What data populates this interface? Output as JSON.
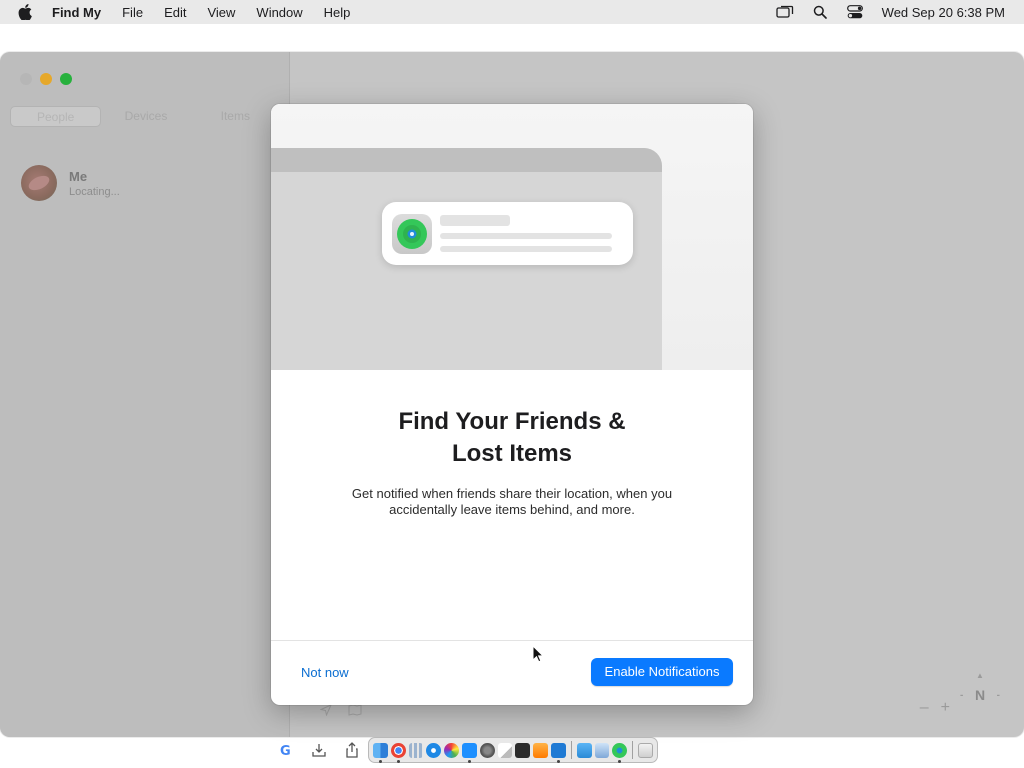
{
  "menubar": {
    "app_name": "Find My",
    "items": [
      "File",
      "Edit",
      "View",
      "Window",
      "Help"
    ],
    "clock": "Wed Sep 20  6:38 PM"
  },
  "sidebar": {
    "tabs": [
      "People",
      "Devices",
      "Items"
    ],
    "person": {
      "name": "Me",
      "status": "Locating..."
    }
  },
  "map": {
    "zoom_out": "–",
    "zoom_in": "+",
    "compass": "N"
  },
  "modal": {
    "title_line1": "Find Your Friends &",
    "title_line2": "Lost Items",
    "body": "Get notified when friends share their location, when you accidentally leave items behind, and more.",
    "secondary_button": "Not now",
    "primary_button": "Enable Notifications"
  },
  "colors": {
    "accent": "#0a7aff",
    "link": "#0b6ed1",
    "findmy_green": "#34c759"
  },
  "dock": {
    "apps": [
      "finder-icon",
      "chrome-icon",
      "launchpad-icon",
      "safari-icon",
      "photos-icon",
      "app-store-icon",
      "settings-icon",
      "notes-icon",
      "terminal-icon",
      "pencil-app-icon",
      "vscode-icon",
      "weather-icon",
      "preview-icon",
      "find-my-icon",
      "trash-icon"
    ]
  }
}
